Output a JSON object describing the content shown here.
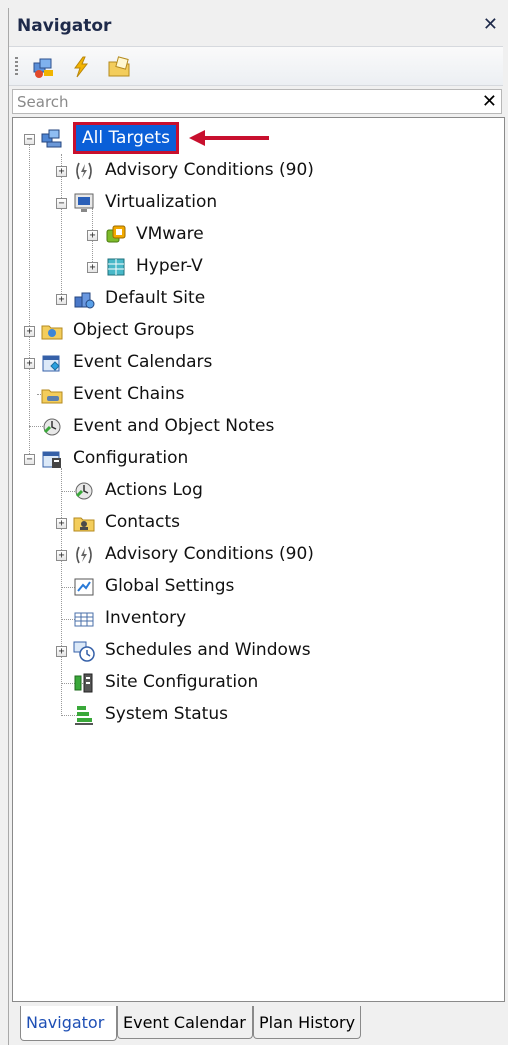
{
  "panel": {
    "title": "Navigator"
  },
  "toolbar": {
    "buttons": [
      "targets-icon",
      "lightning-icon",
      "note-folder-icon"
    ]
  },
  "search": {
    "placeholder": "Search"
  },
  "tree": {
    "all_targets": "All Targets",
    "advisory_conditions_1": "Advisory Conditions (90)",
    "virtualization": "Virtualization",
    "vmware": "VMware",
    "hyperv": "Hyper-V",
    "default_site": "Default Site",
    "object_groups": "Object Groups",
    "event_calendars": "Event Calendars",
    "event_chains": "Event Chains",
    "event_object_notes": "Event and Object Notes",
    "configuration": "Configuration",
    "actions_log": "Actions Log",
    "contacts": "Contacts",
    "advisory_conditions_2": "Advisory Conditions (90)",
    "global_settings": "Global Settings",
    "inventory": "Inventory",
    "schedules_windows": "Schedules and Windows",
    "site_configuration": "Site Configuration",
    "system_status": "System Status"
  },
  "tabs": [
    "Navigator",
    "Event Calendar",
    "Plan History"
  ],
  "colors": {
    "selection": "#0a5fd8",
    "highlight_box": "#c8102e",
    "arrow": "#c8102e"
  }
}
